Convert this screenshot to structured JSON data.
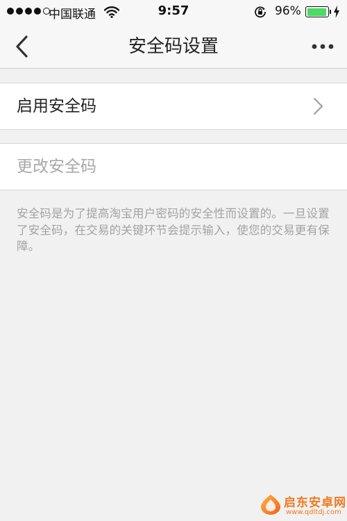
{
  "status_bar": {
    "carrier": "中国联通",
    "time": "9:57",
    "battery_percent": "96%",
    "battery_level": 0.96,
    "signal_bars_filled": 4,
    "signal_bars_total": 5
  },
  "nav": {
    "title": "安全码设置",
    "back_icon": "chevron-left-icon",
    "more_icon": "more-dots-icon"
  },
  "items": {
    "enable_label": "启用安全码",
    "change_label": "更改安全码"
  },
  "description": "安全码是为了提高淘宝用户密码的安全性而设置的。一旦设置了安全码，在交易的关键环节会提示输入，使您的交易更有保障。",
  "watermark": {
    "text": "启东安卓网",
    "url": "www.qdltdj.com"
  },
  "colors": {
    "accent_green": "#4cd964",
    "watermark_orange": "#f07a1f",
    "disabled_text": "#a8a8a8"
  }
}
